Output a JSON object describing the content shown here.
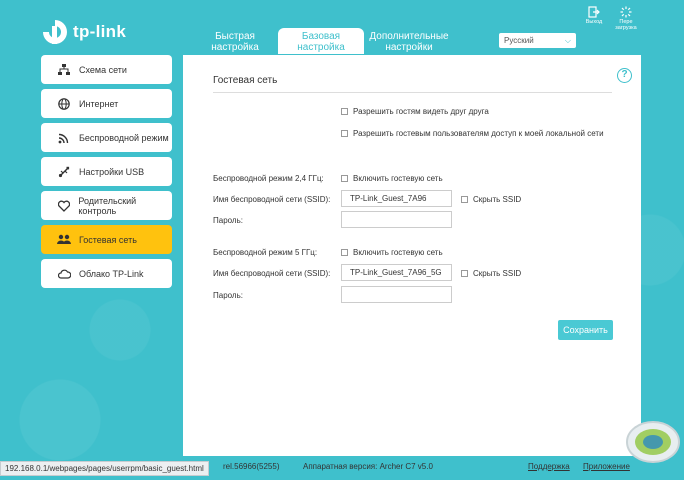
{
  "brand": {
    "name": "tp-link"
  },
  "tabs": [
    {
      "label": "Быстрая настройка",
      "active": false
    },
    {
      "label": "Базовая настройка",
      "active": true
    },
    {
      "label": "Дополнительные настройки",
      "active": false
    }
  ],
  "language": {
    "selected": "Русский"
  },
  "header_buttons": {
    "exit": "Выход",
    "reboot": "Пере загрузка"
  },
  "sidebar": {
    "items": [
      {
        "label": "Схема сети",
        "icon": "network-map-icon"
      },
      {
        "label": "Интернет",
        "icon": "globe-icon"
      },
      {
        "label": "Беспроводной режим",
        "icon": "wifi-icon"
      },
      {
        "label": "Настройки USB",
        "icon": "usb-icon"
      },
      {
        "label": "Родительский контроль",
        "icon": "heart-icon"
      },
      {
        "label": "Гостевая сеть",
        "icon": "guests-icon",
        "active": true
      },
      {
        "label": "Облако TP-Link",
        "icon": "cloud-icon"
      }
    ]
  },
  "main": {
    "title": "Гостевая сеть",
    "options": {
      "see_each_other": "Разрешить гостям видеть друг друга",
      "local_access": "Разрешить гостевым пользователям доступ к моей локальной сети"
    },
    "band24": {
      "label": "Беспроводной режим 2,4 ГГц:",
      "enable_label": "Включить гостевую сеть",
      "ssid_label": "Имя беспроводной сети (SSID):",
      "ssid_value": "TP-Link_Guest_7A96",
      "hide_ssid_label": "Скрыть SSID",
      "password_label": "Пароль:",
      "password_value": ""
    },
    "band5": {
      "label": "Беспроводной режим 5 ГГц:",
      "enable_label": "Включить гостевую сеть",
      "ssid_label": "Имя беспроводной сети (SSID):",
      "ssid_value": "TP-Link_Guest_7A96_5G",
      "hide_ssid_label": "Скрыть SSID",
      "password_label": "Пароль:",
      "password_value": ""
    },
    "save_label": "Сохранить"
  },
  "footer": {
    "url": "192.168.0.1/webpages/pages/userrpm/basic_guest.html",
    "firmware_fragment": "rel.56966(5255)",
    "hardware": "Аппаратная версия: Archer C7 v5.0",
    "support": "Поддержка",
    "app": "Приложение"
  },
  "colors": {
    "accent": "#3fc0cc",
    "active_item": "#ffc20e",
    "save_button": "#4ac9d4"
  }
}
